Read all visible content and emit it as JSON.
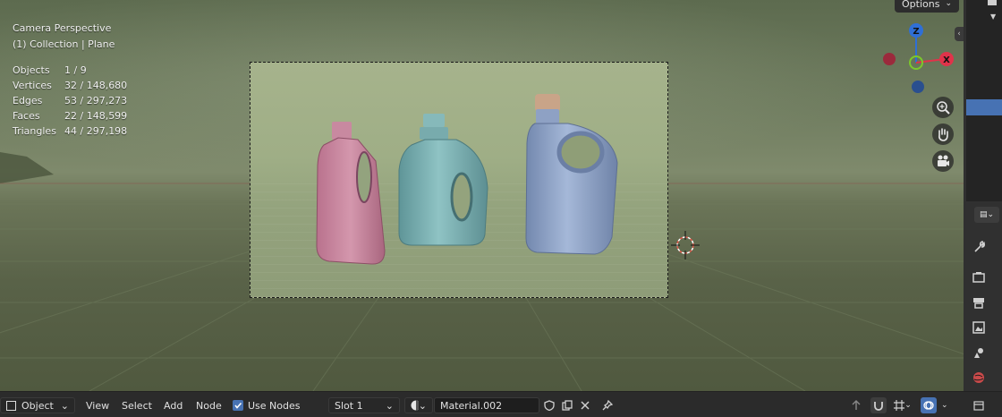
{
  "viewport": {
    "view_name": "Camera Perspective",
    "collection_line": "(1) Collection | Plane",
    "stats": [
      {
        "label": "Objects",
        "value": "1 / 9"
      },
      {
        "label": "Vertices",
        "value": "32 / 148,680"
      },
      {
        "label": "Edges",
        "value": "53 / 297,273"
      },
      {
        "label": "Faces",
        "value": "22 / 148,599"
      },
      {
        "label": "Triangles",
        "value": "44 / 297,198"
      }
    ],
    "options_label": "Options",
    "gizmo": {
      "z": "Z",
      "x": "X"
    }
  },
  "bottom_bar": {
    "mode": "Object",
    "menus": [
      "View",
      "Select",
      "Add",
      "Node"
    ],
    "use_nodes_label": "Use Nodes",
    "use_nodes_checked": true,
    "slot": "Slot 1",
    "material_name": "Material.002"
  },
  "colors": {
    "accent": "#4772b3",
    "gizmo_x": "#e0334a",
    "gizmo_y": "#7cc92b",
    "gizmo_z": "#2f6fd6",
    "bottle_pink": "#c7889f",
    "bottle_teal": "#7fb1b3",
    "bottle_blue": "#8ea4c8"
  },
  "icons": [
    "zoom-icon",
    "hand-pan-icon",
    "camera-icon",
    "cursor-3d-icon",
    "wrench-icon",
    "render-icon",
    "output-icon",
    "view-layer-icon",
    "scene-icon",
    "world-icon",
    "pin-icon",
    "shield-icon",
    "duplicate-icon",
    "close-icon"
  ]
}
